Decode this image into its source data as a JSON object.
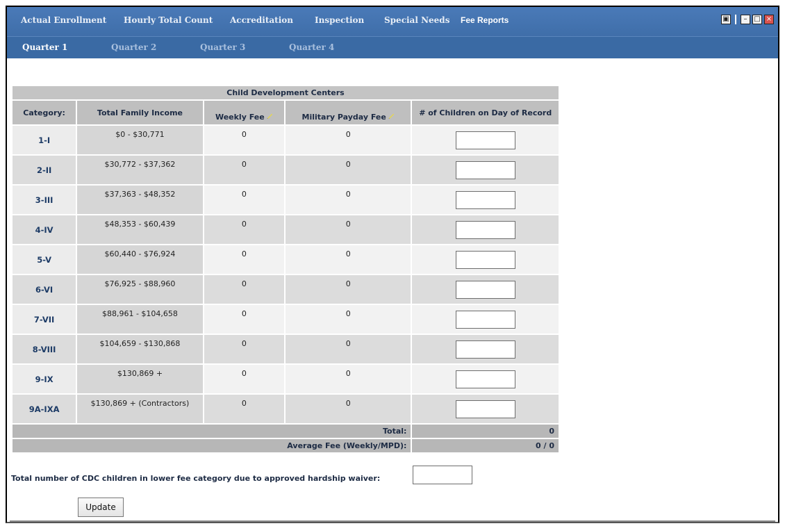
{
  "nav_primary": {
    "items": [
      "Actual Enrollment",
      "Hourly Total Count",
      "Accreditation",
      "Inspection",
      "Special Needs",
      "Fee Reports"
    ],
    "active": "Fee Reports"
  },
  "window_controls": [
    "export-icon",
    "minimize-icon",
    "maximize-icon",
    "close-icon"
  ],
  "nav_secondary": {
    "items": [
      "Quarter 1",
      "Quarter 2",
      "Quarter 3",
      "Quarter 4"
    ],
    "active": "Quarter 1"
  },
  "table": {
    "caption": "Child Development Centers",
    "headers": {
      "category": "Category:",
      "income": "Total Family Income",
      "weekly": "Weekly Fee",
      "mpd": "Military Payday Fee",
      "children": "# of Children on Day of Record"
    },
    "rows": [
      {
        "category": "1-I",
        "income": "$0 - $30,771",
        "weekly": "0",
        "mpd": "0",
        "children": ""
      },
      {
        "category": "2-II",
        "income": "$30,772 - $37,362",
        "weekly": "0",
        "mpd": "0",
        "children": ""
      },
      {
        "category": "3-III",
        "income": "$37,363 - $48,352",
        "weekly": "0",
        "mpd": "0",
        "children": ""
      },
      {
        "category": "4-IV",
        "income": "$48,353 - $60,439",
        "weekly": "0",
        "mpd": "0",
        "children": ""
      },
      {
        "category": "5-V",
        "income": "$60,440 - $76,924",
        "weekly": "0",
        "mpd": "0",
        "children": ""
      },
      {
        "category": "6-VI",
        "income": "$76,925 - $88,960",
        "weekly": "0",
        "mpd": "0",
        "children": ""
      },
      {
        "category": "7-VII",
        "income": "$88,961 - $104,658",
        "weekly": "0",
        "mpd": "0",
        "children": ""
      },
      {
        "category": "8-VIII",
        "income": "$104,659 - $130,868",
        "weekly": "0",
        "mpd": "0",
        "children": ""
      },
      {
        "category": "9-IX",
        "income": "$130,869 +",
        "weekly": "0",
        "mpd": "0",
        "children": ""
      },
      {
        "category": "9A-IXA",
        "income": "$130,869 + (Contractors)",
        "weekly": "0",
        "mpd": "0",
        "children": ""
      }
    ],
    "total_label": "Total:",
    "total_value": "0",
    "average_label": "Average Fee (Weekly/MPD):",
    "average_value": "0 / 0"
  },
  "hardship": {
    "label": "Total number of CDC children in lower fee category due to approved hardship waiver:",
    "value": ""
  },
  "update_button": "Update",
  "colors": {
    "nav_bg": "#4275b0",
    "subnav_bg": "#3a6aa4",
    "header_gray": "#bfbfbf",
    "text_navy": "#1d2b44"
  }
}
